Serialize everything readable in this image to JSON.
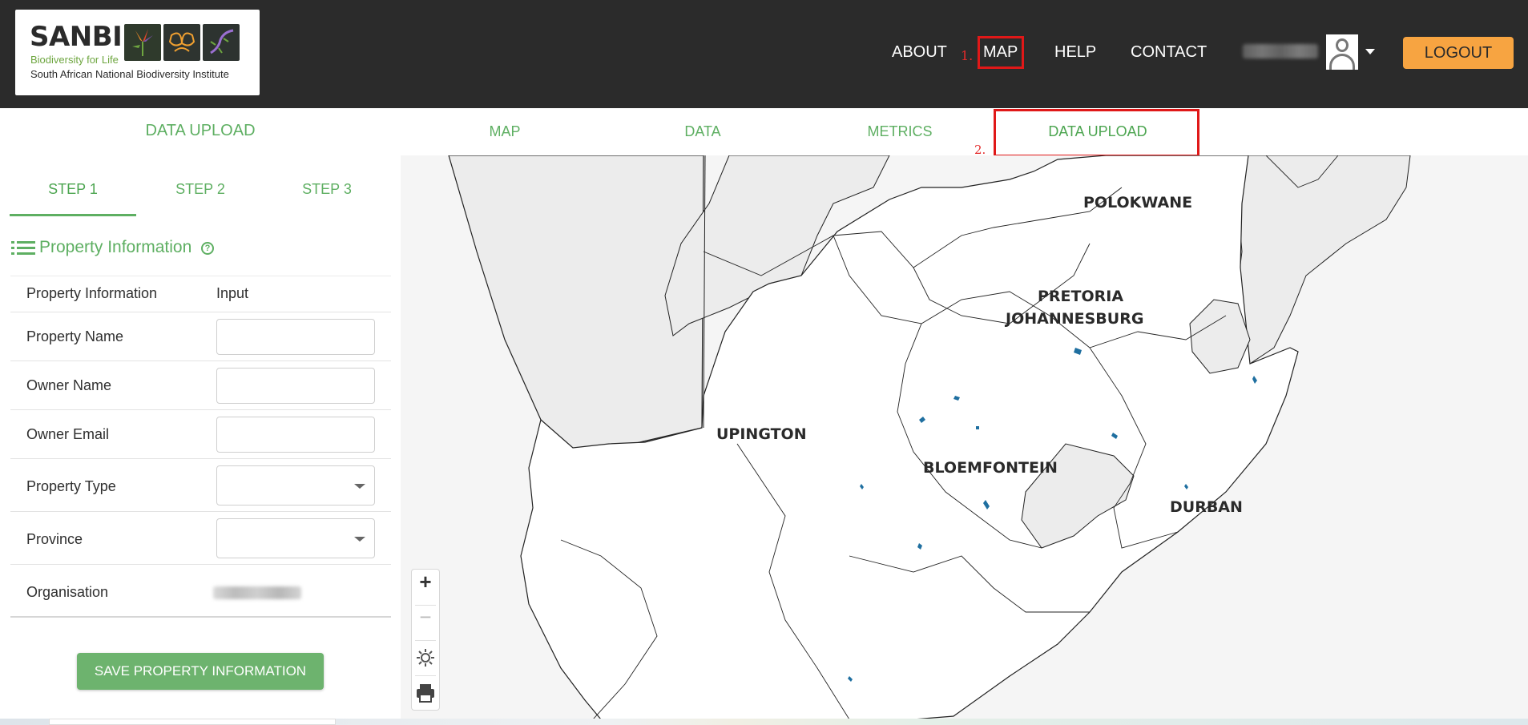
{
  "header": {
    "logo": {
      "word": "SANBI",
      "tagline": "Biodiversity for Life",
      "subtitle": "South African National Biodiversity Institute"
    },
    "nav": {
      "about": "ABOUT",
      "map_number": "1.",
      "map": "MAP",
      "help": "HELP",
      "contact": "CONTACT"
    },
    "logout": "LOGOUT"
  },
  "subnav": {
    "left_title": "DATA UPLOAD",
    "tabs": [
      "MAP",
      "DATA",
      "METRICS",
      "DATA UPLOAD"
    ],
    "upload_number": "2."
  },
  "steps": [
    "STEP 1",
    "STEP 2",
    "STEP 3"
  ],
  "section": {
    "title": "Property Information",
    "help": "?"
  },
  "form": {
    "col_label": "Property Information",
    "col_input": "Input",
    "rows": [
      {
        "label": "Property Name",
        "value": ""
      },
      {
        "label": "Owner Name",
        "value": ""
      },
      {
        "label": "Owner Email",
        "value": ""
      },
      {
        "label": "Property Type",
        "value": ""
      },
      {
        "label": "Province",
        "value": ""
      },
      {
        "label": "Organisation",
        "value": ""
      }
    ]
  },
  "save_button": "SAVE PROPERTY INFORMATION",
  "map": {
    "cities": [
      "POLOKWANE",
      "PRETORIA",
      "JOHANNESBURG",
      "UPINGTON",
      "BLOEMFONTEIN",
      "DURBAN"
    ],
    "controls": {
      "zoom_in": "+",
      "zoom_out": "−"
    }
  },
  "colors": {
    "accent": "#5eaf62",
    "header": "#2b2b2b",
    "logout": "#f7a441",
    "highlight": "#e01818"
  }
}
